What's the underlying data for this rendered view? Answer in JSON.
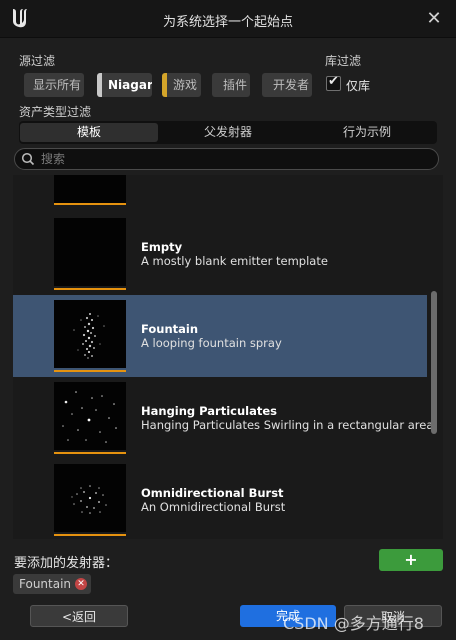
{
  "window": {
    "title": "为系统选择一个起始点",
    "logo": "unreal-logo-icon",
    "close_icon": "close-icon"
  },
  "source_filter": {
    "label": "源过滤",
    "chips": [
      {
        "label": "显示所有",
        "active": false,
        "color": "#3a3a3a"
      },
      {
        "label": "Niagara",
        "active": true,
        "color": "#c8c8c8"
      },
      {
        "label": "游戏",
        "active": false,
        "color": "#d4a52a"
      },
      {
        "label": "插件",
        "active": false,
        "color": "#3a3a3a"
      },
      {
        "label": "开发者",
        "active": false,
        "color": "#3a3a3a"
      }
    ]
  },
  "library_filter": {
    "label": "库过滤",
    "checkbox_label": "仅库",
    "checked": true
  },
  "asset_type_filter": {
    "label": "资产类型过滤",
    "tabs": [
      {
        "label": "模板",
        "active": true
      },
      {
        "label": "父发射器",
        "active": false
      },
      {
        "label": "行为示例",
        "active": false
      }
    ]
  },
  "search": {
    "placeholder": "搜索",
    "value": "",
    "icon": "search-icon"
  },
  "emitters": [
    {
      "name": "Empty",
      "description": "A mostly blank emitter template",
      "selected": false
    },
    {
      "name": "Fountain",
      "description": "A looping fountain spray",
      "selected": true
    },
    {
      "name": "Hanging Particulates",
      "description": "Hanging Particulates Swirling in a rectangular area",
      "selected": false
    },
    {
      "name": "Omnidirectional Burst",
      "description": "An Omnidirectional Burst",
      "selected": false
    }
  ],
  "emitters_to_add": {
    "label": "要添加的发射器：",
    "add_button": "+",
    "items": [
      {
        "label": "Fountain"
      }
    ]
  },
  "footer": {
    "back": "<返回",
    "done": "完成",
    "cancel": "取消"
  },
  "watermark": "CSDN @多方通行8"
}
